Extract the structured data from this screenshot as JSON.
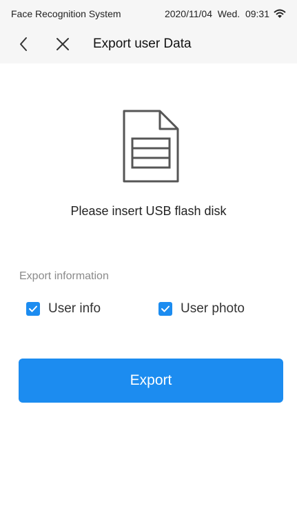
{
  "status_bar": {
    "app_name": "Face Recognition System",
    "datetime": "2020/11/04  Wed.  09:31",
    "wifi_icon": "wifi-icon"
  },
  "nav": {
    "back_icon": "chevron-left-icon",
    "close_icon": "close-icon",
    "title": "Export user Data"
  },
  "main": {
    "illustration_icon": "document-icon",
    "prompt": "Please insert USB flash disk",
    "section_label": "Export information",
    "options": [
      {
        "label": "User info",
        "checked": true
      },
      {
        "label": "User photo",
        "checked": true
      }
    ],
    "export_label": "Export"
  },
  "colors": {
    "accent": "#1c8cf0",
    "header_bg": "#f6f6f6",
    "secondary_text": "#8a8a8a"
  }
}
